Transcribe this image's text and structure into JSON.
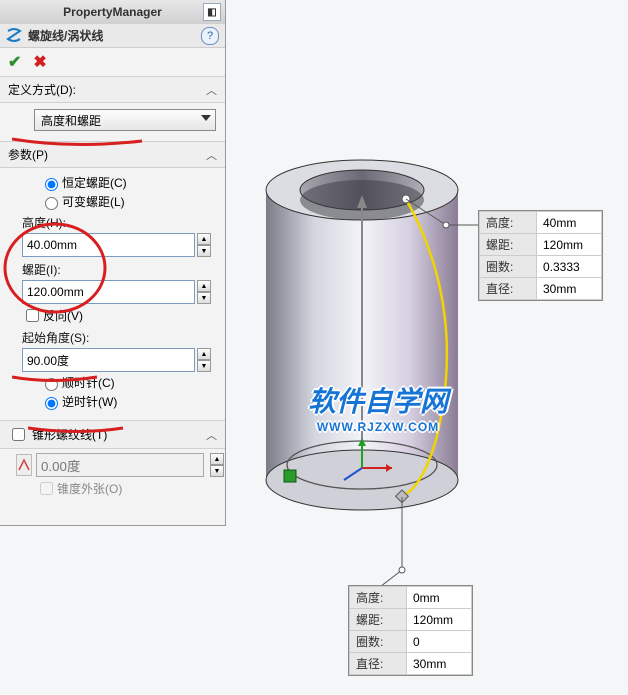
{
  "panel": {
    "title": "PropertyManager",
    "feature": "螺旋线/涡状线",
    "def_section": "定义方式(D):",
    "def_method": "高度和螺距",
    "params_section": "参数(P)",
    "pitch_constant": "恒定螺距(C)",
    "pitch_variable": "可变螺距(L)",
    "height_label": "高度(H):",
    "height_val": "40.00mm",
    "pitch_label": "螺距(I):",
    "pitch_val": "120.00mm",
    "reverse": "反向(V)",
    "start_angle_label": "起始角度(S):",
    "start_angle_val": "90.00度",
    "clockwise": "顺时针(C)",
    "ccw": "逆时针(W)",
    "taper_section": "锥形螺纹线(T)",
    "taper_val": "0.00度",
    "taper_out": "锥度外张(O)"
  },
  "callout1": {
    "height_k": "高度:",
    "height_v": "40mm",
    "pitch_k": "螺距:",
    "pitch_v": "120mm",
    "rev_k": "圈数:",
    "rev_v": "0.3333",
    "dia_k": "直径:",
    "dia_v": "30mm"
  },
  "callout2": {
    "height_k": "高度:",
    "height_v": "0mm",
    "pitch_k": "螺距:",
    "pitch_v": "120mm",
    "rev_k": "圈数:",
    "rev_v": "0",
    "dia_k": "直径:",
    "dia_v": "30mm"
  },
  "watermark": {
    "main": "软件自学网",
    "sub": "WWW.RJZXW.COM"
  }
}
